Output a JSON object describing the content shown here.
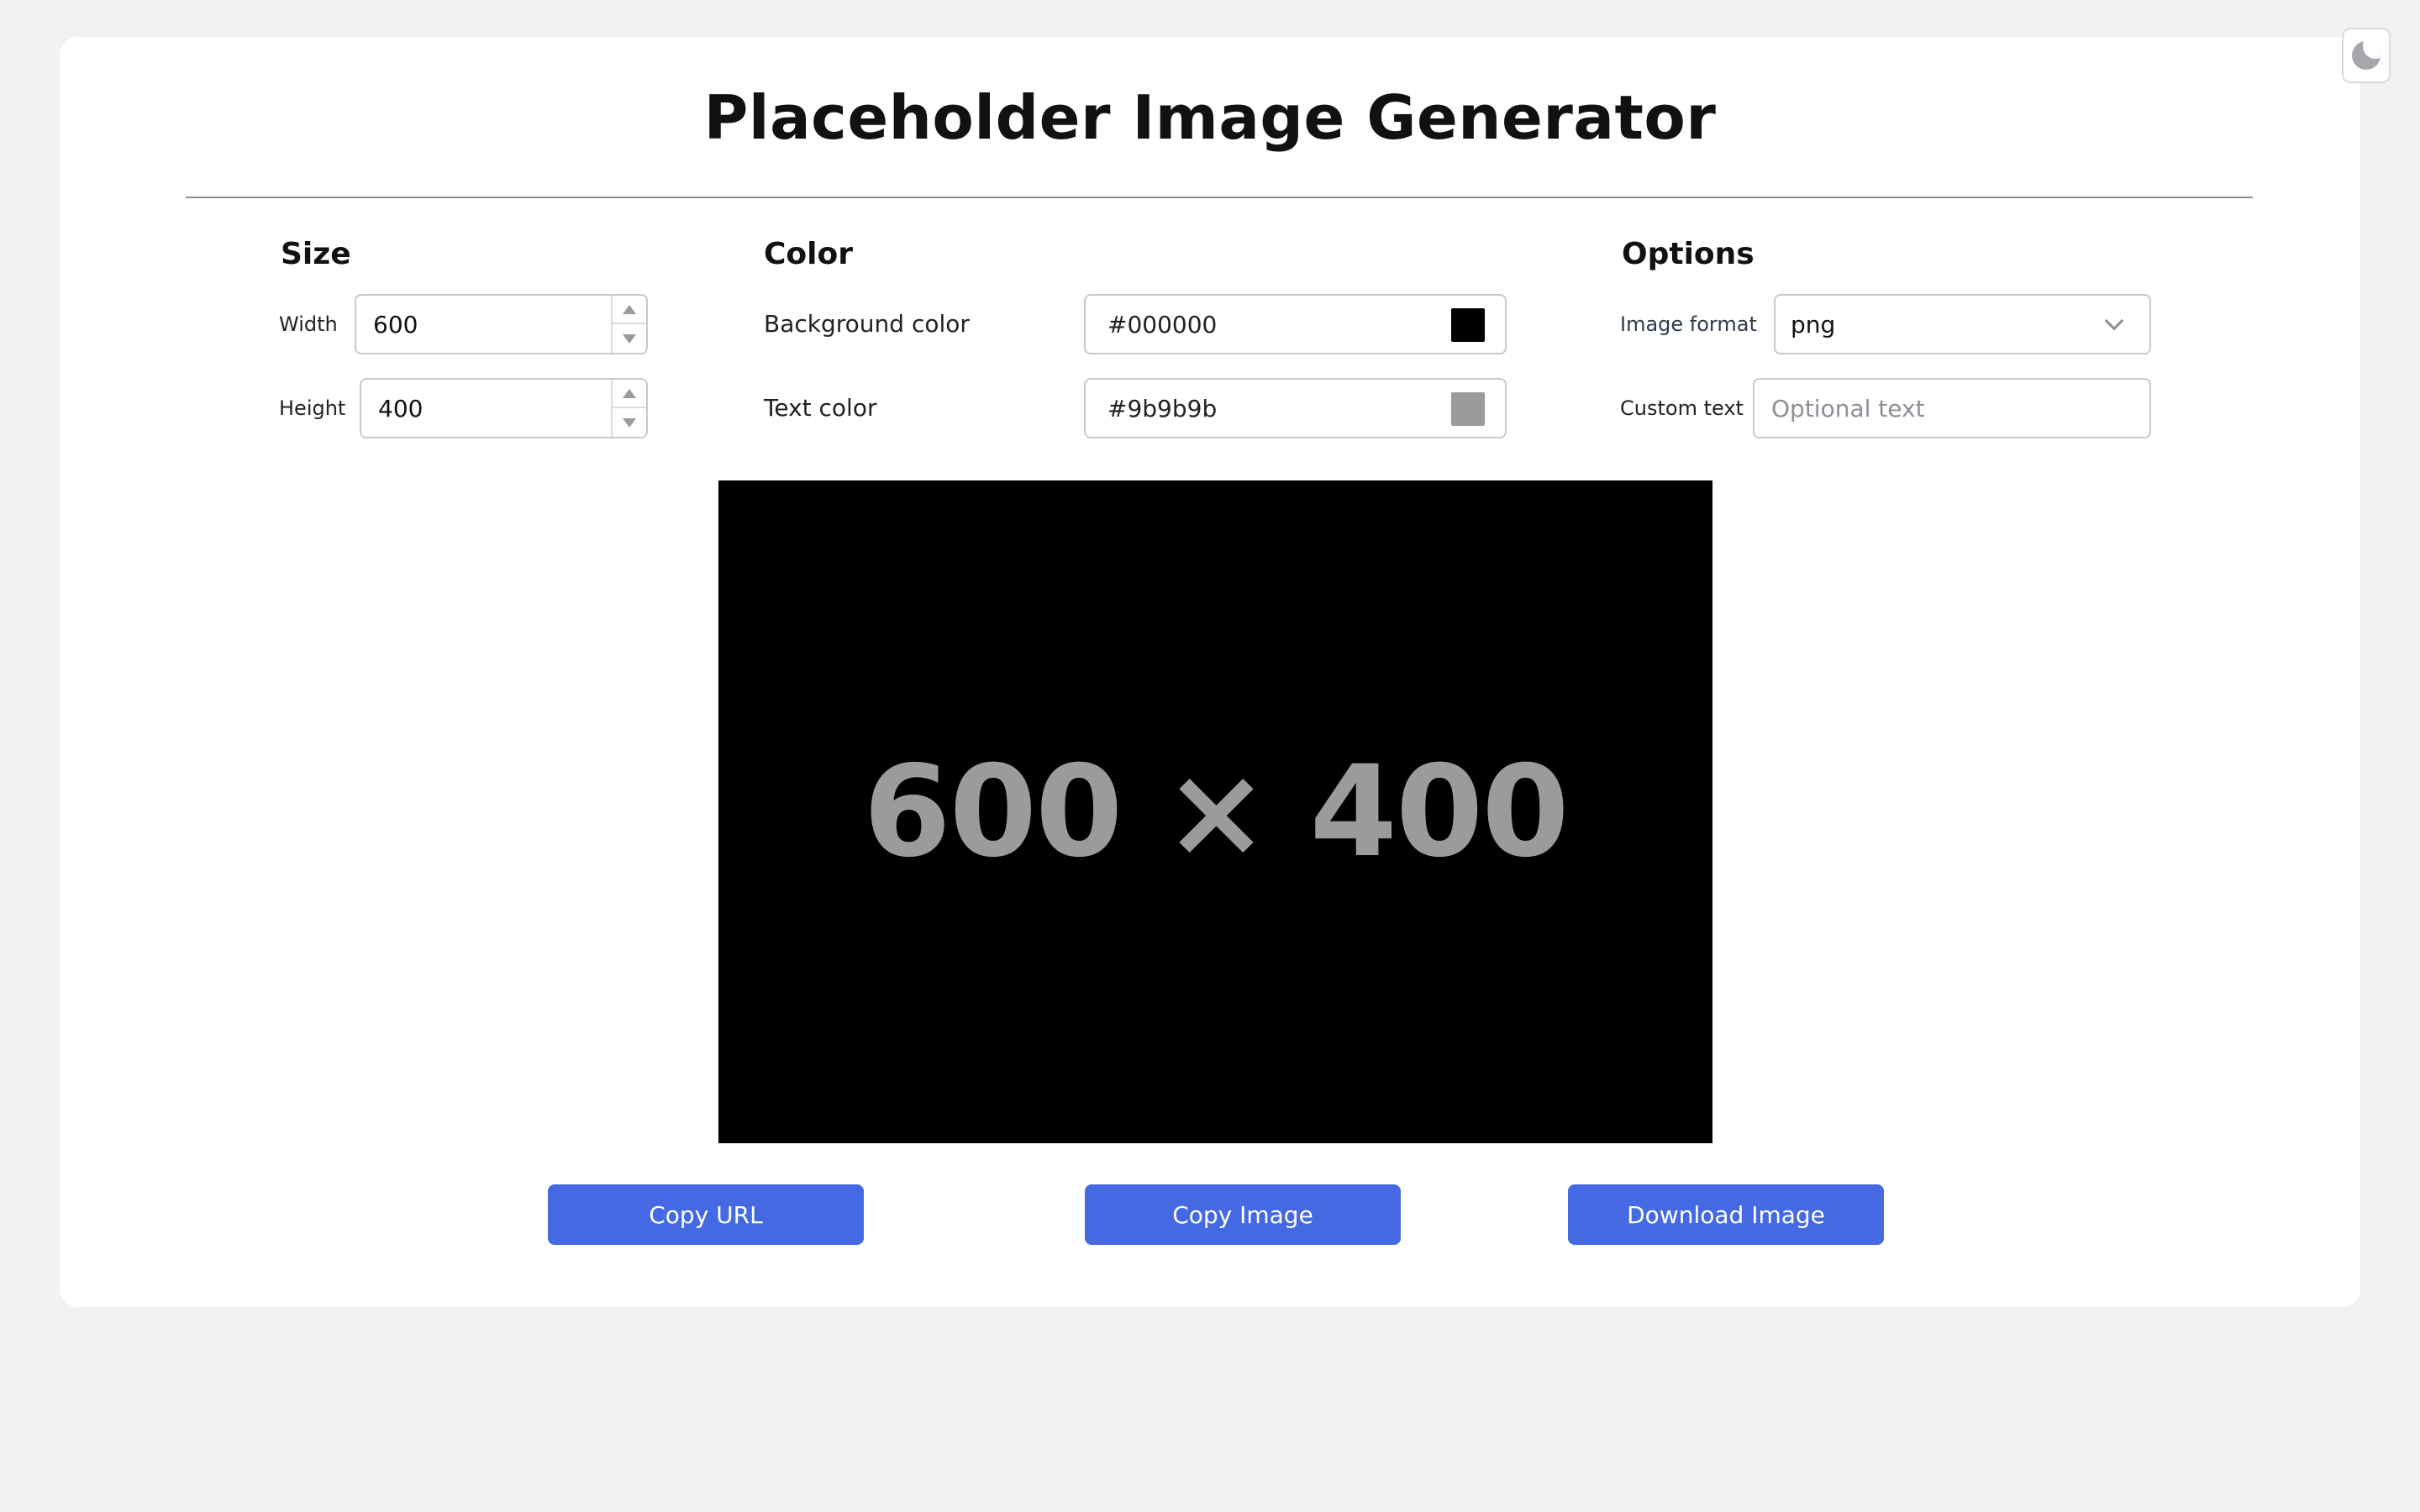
{
  "header": {
    "title": "Placeholder Image Generator"
  },
  "size": {
    "section_title": "Size",
    "width_label": "Width",
    "width_value": "600",
    "height_label": "Height",
    "height_value": "400"
  },
  "color": {
    "section_title": "Color",
    "background_label": "Background color",
    "background_value": "#000000",
    "text_label": "Text color",
    "text_value": "#9b9b9b"
  },
  "options": {
    "section_title": "Options",
    "format_label": "Image format",
    "format_value": "png",
    "custom_text_label": "Custom text",
    "custom_text_value": "",
    "custom_text_placeholder": "Optional text"
  },
  "preview": {
    "text": "600 × 400",
    "background": "#000000",
    "foreground": "#9b9b9b"
  },
  "actions": {
    "copy_url_label": "Copy URL",
    "copy_image_label": "Copy Image",
    "download_label": "Download Image",
    "accent": "#4568e3"
  },
  "icons": {
    "theme_toggle": "moon-icon",
    "format_dropdown": "chevron-down-icon"
  }
}
